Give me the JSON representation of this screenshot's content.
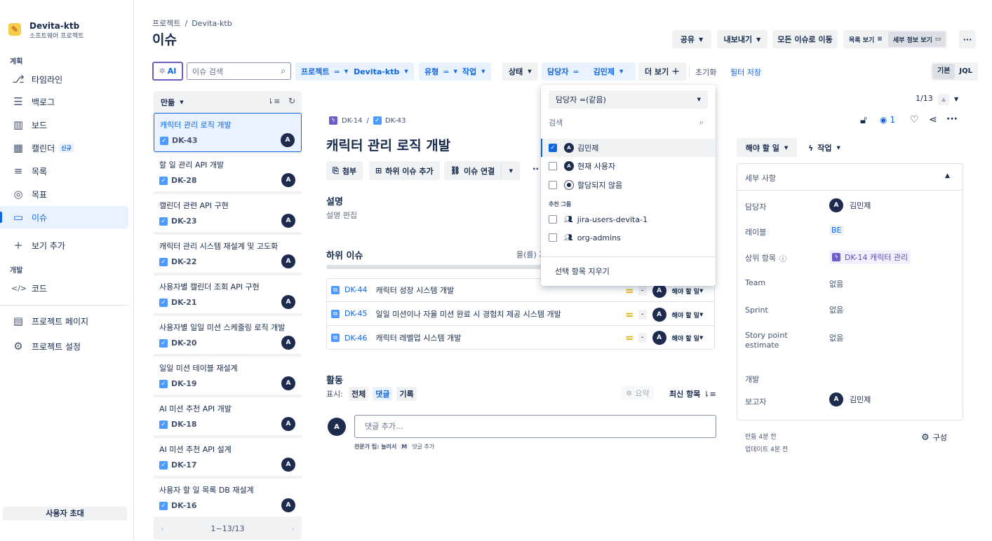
{
  "sidebar": {
    "project_name": "Devita-ktb",
    "project_type": "소프트웨어 프로젝트",
    "section_plan": "계획",
    "section_dev": "개발",
    "items": [
      {
        "label": "타임라인",
        "icon": "timeline-icon",
        "glyph": "⎇"
      },
      {
        "label": "백로그",
        "icon": "backlog-icon",
        "glyph": "☰"
      },
      {
        "label": "보드",
        "icon": "board-icon",
        "glyph": "▥"
      },
      {
        "label": "캘린더",
        "icon": "calendar-icon",
        "glyph": "▦",
        "badge": "신규"
      },
      {
        "label": "목록",
        "icon": "list-icon",
        "glyph": "≡"
      },
      {
        "label": "목표",
        "icon": "goal-icon",
        "glyph": "◎"
      },
      {
        "label": "이슈",
        "icon": "issue-icon",
        "glyph": "▭"
      },
      {
        "label": "보기 추가",
        "icon": "plus-icon",
        "glyph": "+"
      },
      {
        "label": "코드",
        "icon": "code-icon",
        "glyph": "</>"
      },
      {
        "label": "프로젝트 페이지",
        "icon": "page-icon",
        "glyph": "▤"
      },
      {
        "label": "프로젝트 설정",
        "icon": "gear-icon",
        "glyph": "⚙"
      }
    ],
    "invite_label": "사용자 초대"
  },
  "header": {
    "breadcrumb_root": "프로젝트",
    "breadcrumb_sep": "/",
    "breadcrumb_project": "Devita-ktb",
    "title": "이슈",
    "share": "공유",
    "export": "내보내기",
    "goto_all": "모든 이슈로 이동",
    "list_view": "목록 보기",
    "detail_view": "세부 정보 보기",
    "more": "···"
  },
  "filters": {
    "ai": "AI",
    "search_placeholder": "이슈 검색",
    "project_label": "프로젝트",
    "project_op": "=",
    "project_value": "Devita-ktb",
    "type_label": "유형",
    "type_op": "=",
    "type_value": "작업",
    "status_label": "상태",
    "assignee_label": "담당자",
    "assignee_op": "=",
    "assignee_value": "김민제",
    "more": "더 보기",
    "reset": "초기화",
    "save": "필터 저장",
    "basic": "기본",
    "jql": "JQL"
  },
  "list": {
    "sort_label": "만듦",
    "footer": "1~13/13",
    "cards": [
      {
        "title": "캐릭터 관리 로직 개발",
        "key": "DK-43",
        "selected": true
      },
      {
        "title": "할 일 관리 API 개발",
        "key": "DK-28"
      },
      {
        "title": "캘린더 관련 API 구현",
        "key": "DK-23"
      },
      {
        "title": "캐릭터 관리 시스템 재설계 및 고도화",
        "key": "DK-22"
      },
      {
        "title": "사용자별 캘린더 조회 API 구현",
        "key": "DK-21"
      },
      {
        "title": "사용자별 일일 미션 스케줄링 로직 개발",
        "key": "DK-20"
      },
      {
        "title": "일일 미션 테이블 재설계",
        "key": "DK-19"
      },
      {
        "title": "AI 미션 추천 API 개발",
        "key": "DK-18"
      },
      {
        "title": "AI 미션 추천 API 설계",
        "key": "DK-17"
      },
      {
        "title": "사용자 할 일 목록 DB 재설계",
        "key": "DK-16"
      }
    ],
    "avatar": "A"
  },
  "issue": {
    "parent_key": "DK-14",
    "key": "DK-43",
    "title": "캐릭터 관리 로직 개발",
    "attach": "첨부",
    "add_child": "하위 이슈 추가",
    "link": "이슈 연결",
    "desc_heading": "설명",
    "desc_edit": "설명 편집",
    "child_heading": "하위 이슈",
    "child_progress": "을(를) 기",
    "children": [
      {
        "key": "DK-44",
        "title": "캐릭터 성장 시스템 개발",
        "status": "해야 할 일"
      },
      {
        "key": "DK-45",
        "title": "일일 미션이나 자율 미션 완료 시 경험치 제공 시스템 개발",
        "status": "해야 할 일"
      },
      {
        "key": "DK-46",
        "title": "캐릭터 레벨업 시스템 개발",
        "status": "해야 할 일"
      }
    ],
    "priority_dash": "-",
    "activity_heading": "활동",
    "show_label": "표시:",
    "tab_all": "전체",
    "tab_comments": "댓글",
    "tab_history": "기록",
    "summary": "요약",
    "latest": "최신 항목",
    "comment_placeholder": "댓글 추가...",
    "tip_prefix": "전문가 팁: 눌러서",
    "tip_key": "M",
    "tip_suffix": "댓글 추가"
  },
  "detail": {
    "pager": "1/13",
    "watch_count": "1",
    "status": "해야 할 일",
    "action": "작업",
    "section": "세부 사항",
    "assignee_label": "담당자",
    "assignee_value": "김민제",
    "labels_label": "레이블",
    "labels_value": "BE",
    "parent_label": "상위 항목",
    "parent_value": "DK-14 캐릭터 관리",
    "team_label": "Team",
    "team_value": "없음",
    "sprint_label": "Sprint",
    "sprint_value": "없음",
    "sp_label_1": "Story point",
    "sp_label_2": "estimate",
    "sp_value": "없음",
    "dev_label": "개발",
    "reporter_label": "보고자",
    "reporter_value": "김민제",
    "created": "만듦 4분 전",
    "updated": "업데이트 4분 전",
    "configure": "구성"
  },
  "dropdown": {
    "header": "담당자 =(같음)",
    "search": "검색",
    "options": [
      {
        "label": "김민제",
        "checked": true,
        "avatar": "A"
      },
      {
        "label": "현재 사용자",
        "checked": false,
        "avatar": "A"
      },
      {
        "label": "할당되지 않음",
        "checked": false,
        "avatar": "person"
      }
    ],
    "group_heading": "추천 그룹",
    "groups": [
      {
        "label": "jira-users-devita-1"
      },
      {
        "label": "org-admins"
      }
    ],
    "clear": "선택 항목 지우기"
  },
  "colors": {
    "accent": "#0c66e4",
    "selected_bg": "#e9f2ff",
    "avatar": "#1d2b4f",
    "epic": "#6e5dc6",
    "task": "#4c9aff",
    "priority": "#e2b203"
  }
}
